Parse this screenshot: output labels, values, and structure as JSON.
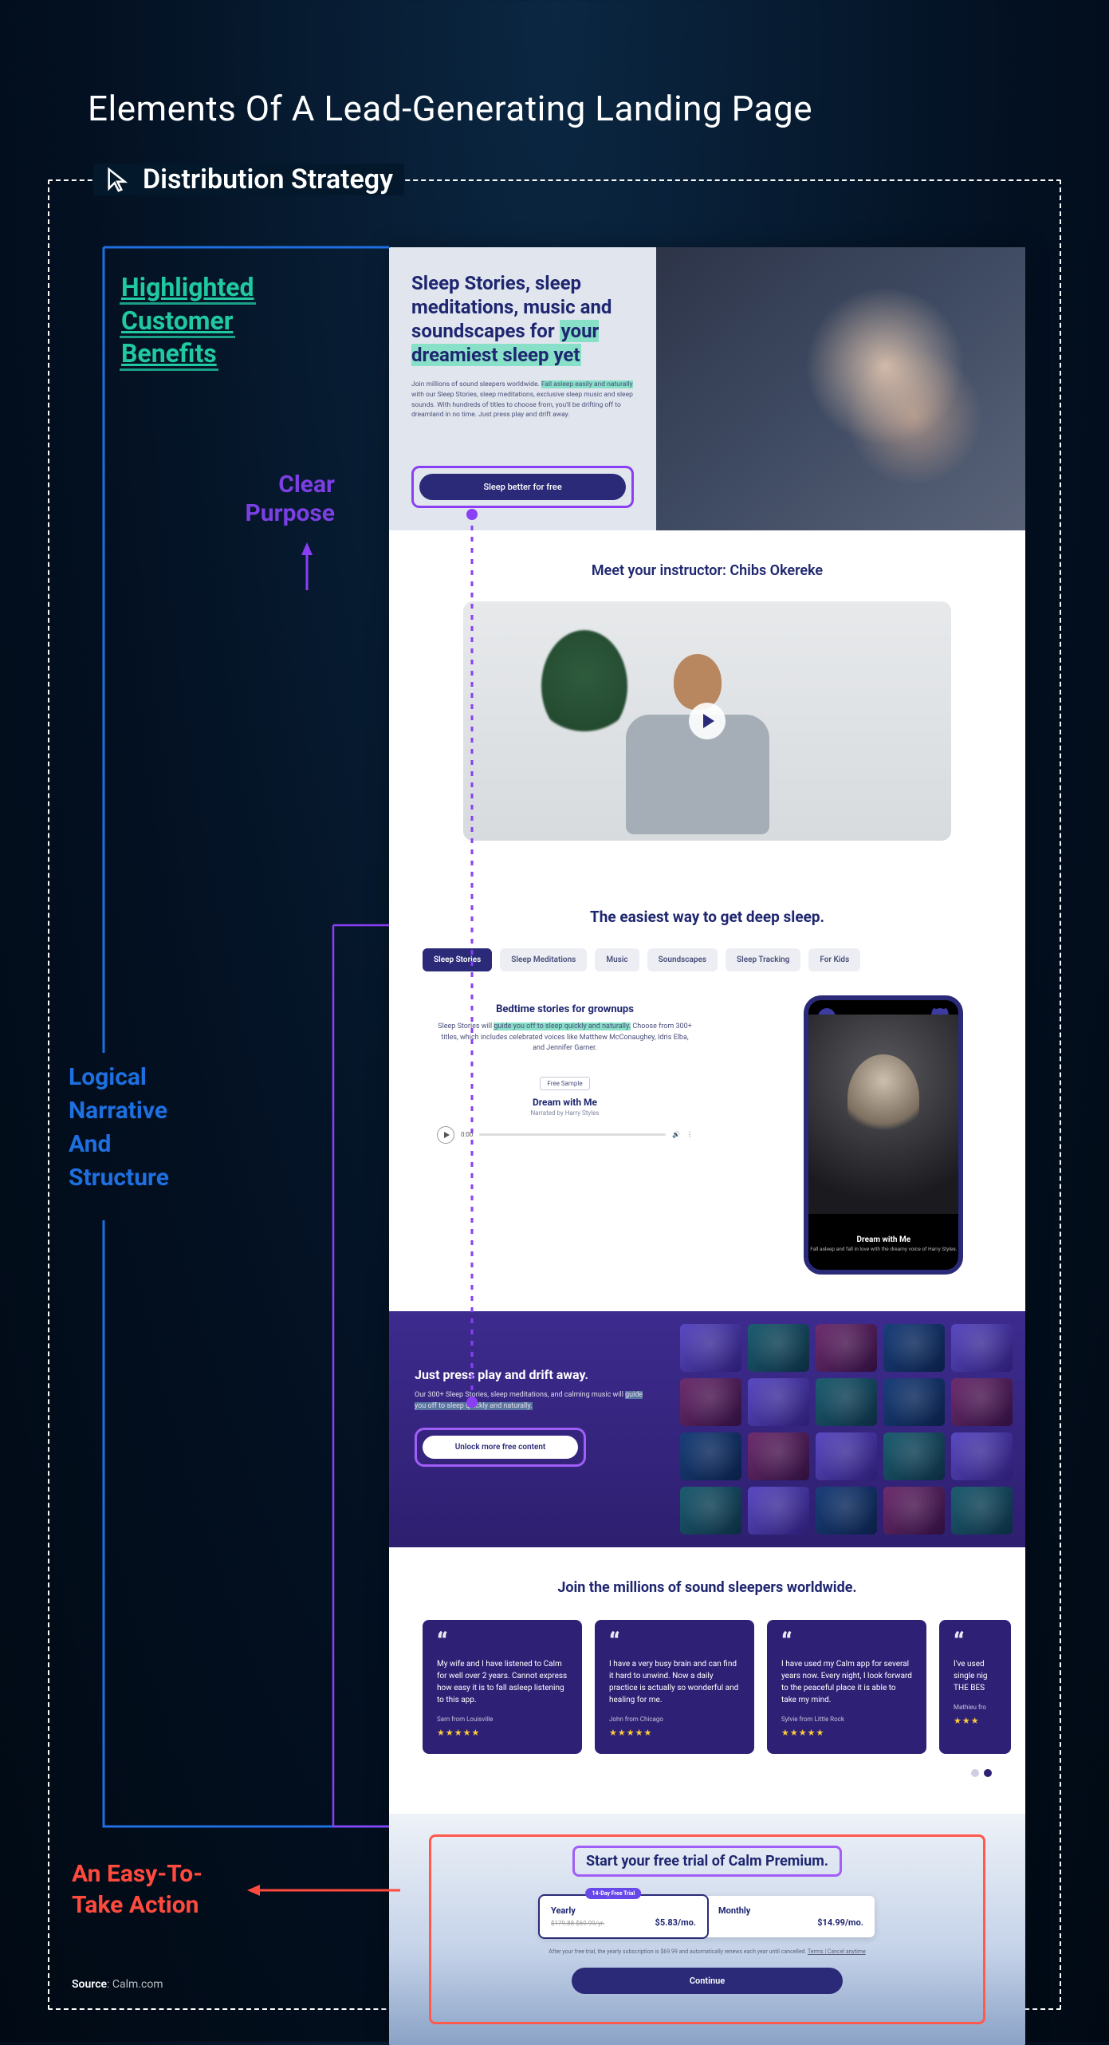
{
  "title": "Elements Of A Lead-Generating Landing Page",
  "section_label": "Distribution Strategy",
  "annotations": {
    "benefits_line1": "Highlighted",
    "benefits_line2": "Customer",
    "benefits_line3": "Benefits",
    "purpose_line1": "Clear",
    "purpose_line2": "Purpose",
    "narrative_line1": "Logical",
    "narrative_line2": "Narrative",
    "narrative_line3": "And",
    "narrative_line4": "Structure",
    "action_line1": "An Easy-To-",
    "action_line2": "Take Action"
  },
  "hero": {
    "title_pre": "Sleep Stories, sleep meditations, music and soundscapes for ",
    "title_hl": "your dreamiest sleep yet",
    "sub_pre": "Join millions of sound sleepers worldwide. ",
    "sub_hl": "Fall asleep easily and naturally",
    "sub_post": " with our Sleep Stories, sleep meditations, exclusive sleep music and sleep sounds. With hundreds of titles to choose from, you'll be drifting off to dreamland in no time. Just press play and drift away.",
    "cta": "Sleep better for free"
  },
  "instructor": {
    "title": "Meet your instructor: Chibs Okereke"
  },
  "deep": {
    "title": "The easiest way to get deep sleep.",
    "tabs": [
      "Sleep Stories",
      "Sleep Meditations",
      "Music",
      "Soundscapes",
      "Sleep Tracking",
      "For Kids"
    ],
    "story": {
      "heading": "Bedtime stories for grownups",
      "p_pre": "Sleep Stories will ",
      "p_hl": "guide you off to sleep quickly and naturally.",
      "p_post": " Choose from 300+ titles, which includes celebrated voices like Matthew McConaughey, Idris Elba, and Jennifer Garner.",
      "sample_badge": "Free Sample",
      "sample_name": "Dream with Me",
      "sample_by": "Narrated by Harry Styles",
      "audio_time": "0:00"
    },
    "phone": {
      "title": "Dream with Me",
      "sub": "Fall asleep and fall in love with the dreamy voice of Harry Styles."
    }
  },
  "drift": {
    "heading": "Just press play and drift away.",
    "p_pre": "Our 300+ Sleep Stories, sleep meditations, and calming music will ",
    "p_hl": "guide you off to sleep quickly and naturally.",
    "cta": "Unlock more free content"
  },
  "testimonials": {
    "title": "Join the millions of sound sleepers worldwide.",
    "cards": [
      {
        "text": "My wife and I have listened to Calm for well over 2 years. Cannot express how easy it is to fall asleep listening to this app.",
        "who": "Sam from Louisville",
        "stars": "★★★★★"
      },
      {
        "text": "I have a very busy brain and can find it hard to unwind. Now a daily practice is actually so wonderful and healing for me.",
        "who": "John from Chicago",
        "stars": "★★★★★"
      },
      {
        "text": "I have used my Calm app for several years now. Every night, I look forward to the peaceful place it is able to take my mind.",
        "who": "Sylvie from Little Rock",
        "stars": "★★★★★"
      },
      {
        "text": "I've used single nig THE BES",
        "who": "Mathieu fro",
        "stars": "★★★"
      }
    ]
  },
  "trial": {
    "heading": "Start your free trial of Calm Premium.",
    "badge": "14-Day Free Trial",
    "yearly": {
      "name": "Yearly",
      "strike": "$179.88 $69.99/yr.",
      "price": "$5.83/mo."
    },
    "monthly": {
      "name": "Monthly",
      "price": "$14.99/mo."
    },
    "note_pre": "After your free trial, the yearly subscription is $69.99 and automatically renews each year until cancelled. ",
    "note_link": "Terms | Cancel anytime",
    "continue": "Continue"
  },
  "source_label": "Source",
  "source_value": ": Calm.com"
}
